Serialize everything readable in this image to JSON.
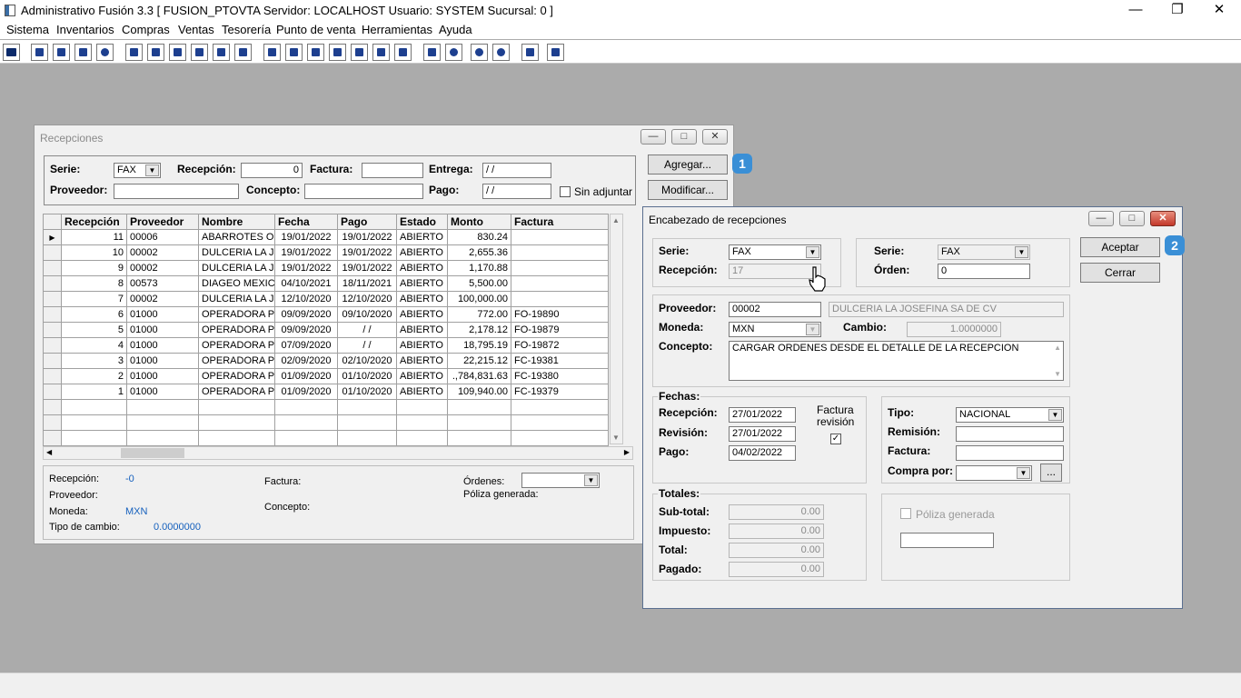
{
  "app": {
    "title": "Administrativo Fusión 3.3 [ FUSION_PTOVTA  Servidor: LOCALHOST  Usuario: SYSTEM    Sucursal: 0 ]",
    "menu": [
      "Sistema",
      "Inventarios",
      "Compras",
      "Ventas",
      "Tesorería",
      "Punto de venta",
      "Herramientas",
      "Ayuda"
    ]
  },
  "recepciones": {
    "title": "Recepciones",
    "filters": {
      "serie_label": "Serie:",
      "serie_value": "FAX",
      "recepcion_label": "Recepción:",
      "recepcion_value": "0",
      "factura_label": "Factura:",
      "factura_value": "",
      "entrega_label": "Entrega:",
      "entrega_value": " / /",
      "proveedor_label": "Proveedor:",
      "proveedor_value": "",
      "concepto_label": "Concepto:",
      "concepto_value": "",
      "pago_label": "Pago:",
      "pago_value": " / /",
      "sin_adjuntar_label": "Sin adjuntar"
    },
    "buttons": {
      "agregar": "Agregar...",
      "modificar": "Modificar..."
    },
    "badge1": "1",
    "table": {
      "columns": [
        "Recepción",
        "Proveedor",
        "Nombre",
        "Fecha",
        "Pago",
        "Estado",
        "Monto",
        "Factura"
      ],
      "rows": [
        [
          "11",
          "00006",
          "ABARROTES OR",
          "19/01/2022",
          "19/01/2022",
          "ABIERTO",
          "830.24",
          ""
        ],
        [
          "10",
          "00002",
          "DULCERIA LA JC",
          "19/01/2022",
          "19/01/2022",
          "ABIERTO",
          "2,655.36",
          ""
        ],
        [
          "9",
          "00002",
          "DULCERIA LA JC",
          "19/01/2022",
          "19/01/2022",
          "ABIERTO",
          "1,170.88",
          ""
        ],
        [
          "8",
          "00573",
          "DIAGEO MEXICO",
          "04/10/2021",
          "18/11/2021",
          "ABIERTO",
          "5,500.00",
          ""
        ],
        [
          "7",
          "00002",
          "DULCERIA LA JC",
          "12/10/2020",
          "12/10/2020",
          "ABIERTO",
          "100,000.00",
          ""
        ],
        [
          "6",
          "01000",
          "OPERADORA PF",
          "09/09/2020",
          "09/10/2020",
          "ABIERTO",
          "772.00",
          "FO-19890"
        ],
        [
          "5",
          "01000",
          "OPERADORA PF",
          "09/09/2020",
          " / /",
          "ABIERTO",
          "2,178.12",
          "FO-19879"
        ],
        [
          "4",
          "01000",
          "OPERADORA PF",
          "07/09/2020",
          " / /",
          "ABIERTO",
          "18,795.19",
          "FO-19872"
        ],
        [
          "3",
          "01000",
          "OPERADORA PF",
          "02/09/2020",
          "02/10/2020",
          "ABIERTO",
          "22,215.12",
          "FC-19381"
        ],
        [
          "2",
          "01000",
          "OPERADORA PF",
          "01/09/2020",
          "01/10/2020",
          "ABIERTO",
          ".,784,831.63",
          "FC-19380"
        ],
        [
          "1",
          "01000",
          "OPERADORA PF",
          "01/09/2020",
          "01/10/2020",
          "ABIERTO",
          "109,940.00",
          "FC-19379"
        ]
      ]
    },
    "footer": {
      "recepcion_label": "Recepción:",
      "recepcion_value": "-0",
      "proveedor_label": "Proveedor:",
      "moneda_label": "Moneda:",
      "moneda_value": "MXN",
      "tipo_cambio_label": "Tipo de cambio:",
      "tipo_cambio_value": "0.0000000",
      "factura_label": "Factura:",
      "concepto_label": "Concepto:",
      "ordenes_label": "Órdenes:",
      "poliza_label": "Póliza generada:"
    }
  },
  "encabezado": {
    "title": "Encabezado de recepciones",
    "serie_label": "Serie:",
    "serie_value": "FAX",
    "recepcion_label": "Recepción:",
    "recepcion_value": "17",
    "serie2_label": "Serie:",
    "serie2_value": "FAX",
    "orden_label": "Órden:",
    "orden_value": "0",
    "proveedor_label": "Proveedor:",
    "proveedor_code": "00002",
    "proveedor_name": "DULCERIA LA JOSEFINA SA DE CV",
    "moneda_label": "Moneda:",
    "moneda_value": "MXN",
    "cambio_label": "Cambio:",
    "cambio_value": "1.0000000",
    "concepto_label": "Concepto:",
    "concepto_value": "CARGAR ORDENES DESDE EL DETALLE DE LA RECEPCION",
    "fechas_label": "Fechas:",
    "fecha_recepcion_label": "Recepción:",
    "fecha_recepcion_value": "27/01/2022",
    "revision_label": "Revisión:",
    "revision_value": "27/01/2022",
    "pago_label": "Pago:",
    "pago_value": "04/02/2022",
    "factura_revision_label1": "Factura",
    "factura_revision_label2": "revisión",
    "tipo_label": "Tipo:",
    "tipo_value": "NACIONAL",
    "remision_label": "Remisión:",
    "remision_value": "",
    "factura_label": "Factura:",
    "factura_value": "",
    "compra_por_label": "Compra por:",
    "compra_por_value": "",
    "ellipsis": "...",
    "totales_label": "Totales:",
    "subtotal_label": "Sub-total:",
    "subtotal_value": "0.00",
    "impuesto_label": "Impuesto:",
    "impuesto_value": "0.00",
    "total_label": "Total:",
    "total_value": "0.00",
    "pagado_label": "Pagado:",
    "pagado_value": "0.00",
    "poliza_label": "Póliza generada",
    "buttons": {
      "aceptar": "Aceptar",
      "cerrar": "Cerrar"
    },
    "badge2": "2"
  }
}
